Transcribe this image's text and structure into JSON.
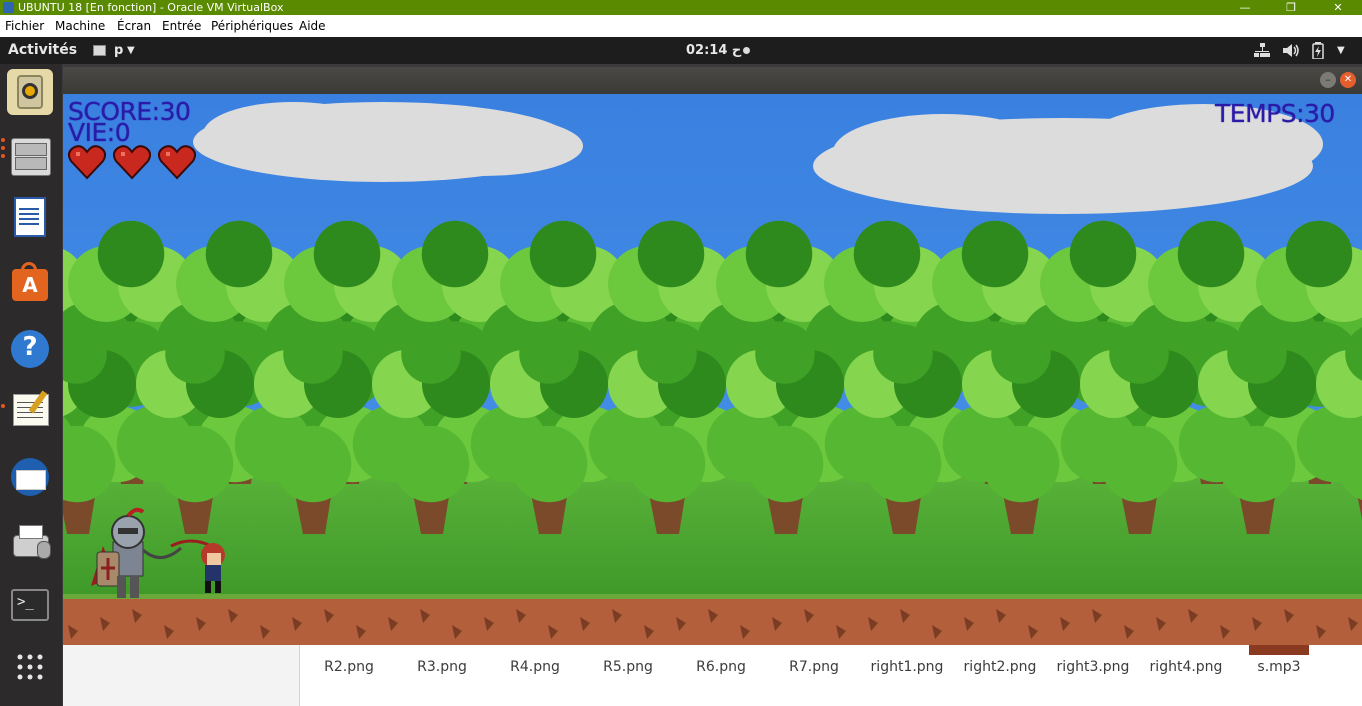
{
  "host_window": {
    "title": "UBUNTU 18 [En fonction] - Oracle VM VirtualBox",
    "controls": [
      "—",
      "❐",
      "✕"
    ],
    "menu": [
      "Fichier",
      "Machine",
      "Écran",
      "Entrée",
      "Périphériques",
      "Aide"
    ]
  },
  "gnome_bar": {
    "activities": "Activités",
    "app_menu": "p",
    "clock": "02:14 ح",
    "status_icons": [
      "network-icon",
      "volume-icon",
      "battery-icon",
      "system-menu-icon"
    ]
  },
  "dock": {
    "items": [
      "rhythmbox-icon",
      "files-icon",
      "libreoffice-writer-icon",
      "software-center-icon",
      "help-icon",
      "text-editor-icon",
      "thunderbird-icon",
      "printer-icon",
      "terminal-icon",
      "show-apps-icon"
    ]
  },
  "game": {
    "hud": {
      "score_text": "SCORE:30",
      "lives_text": "VIE:0",
      "time_text": "TEMPS:30",
      "hearts": 3
    }
  },
  "file_strip": {
    "files": [
      "R2.png",
      "R3.png",
      "R4.png",
      "R5.png",
      "R6.png",
      "R7.png",
      "right1.png",
      "right2.png",
      "right3.png",
      "right4.png",
      "s.mp3"
    ]
  },
  "colors": {
    "vbox_title_bg": "#5a8a00",
    "hud_text": "#2a1aa8",
    "ubuntu_orange": "#e95420",
    "sky": "#3f88e4",
    "ground": "#b35f3c"
  }
}
